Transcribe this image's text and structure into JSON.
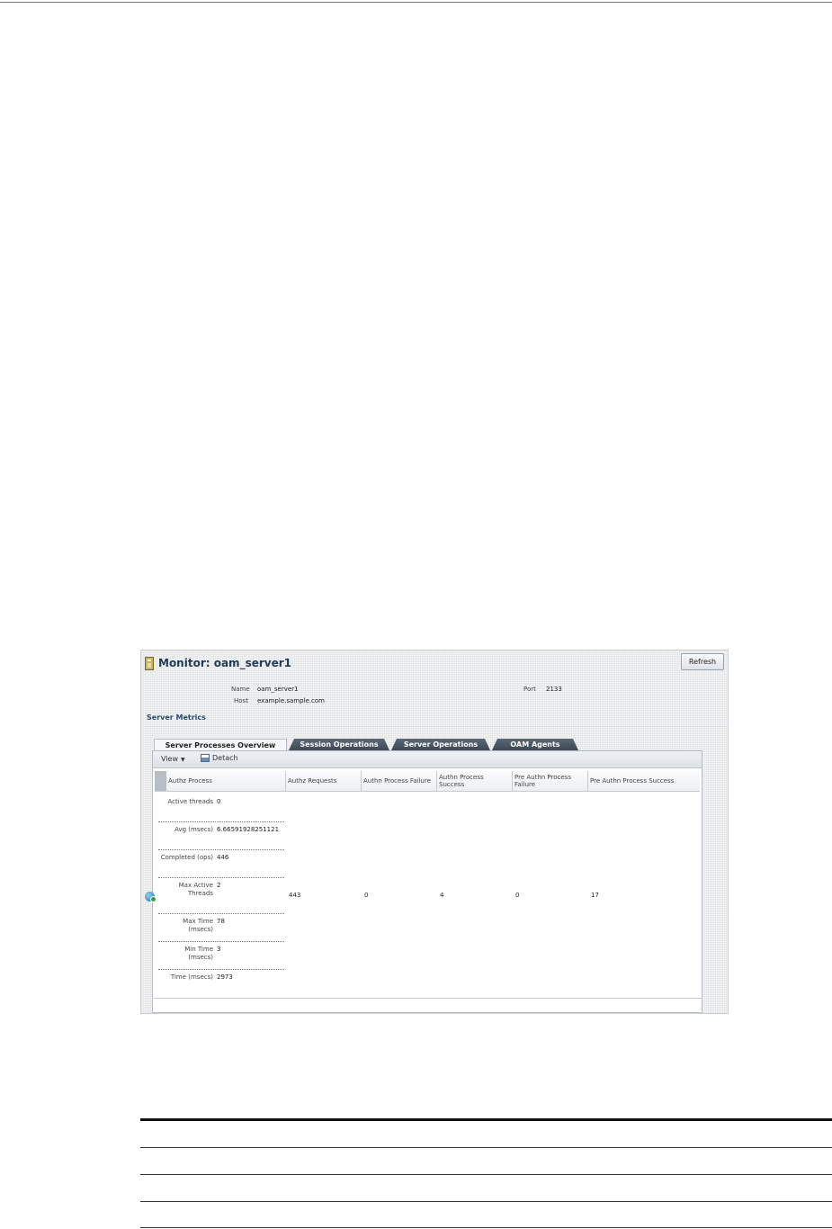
{
  "window": {
    "title": "Monitor: oam_server1",
    "refresh_label": "Refresh"
  },
  "server_info": {
    "name_label": "Name",
    "name_value": "oam_server1",
    "host_label": "Host",
    "host_value": "example.sample.com",
    "port_label": "Port",
    "port_value": "2133"
  },
  "section": {
    "title": "Server Metrics"
  },
  "tabs": [
    {
      "label": "Server Processes Overview",
      "active": true
    },
    {
      "label": "Session Operations",
      "active": false
    },
    {
      "label": "Server Operations",
      "active": false
    },
    {
      "label": "OAM Agents",
      "active": false
    }
  ],
  "toolbar": {
    "view_label": "View",
    "detach_label": "Detach"
  },
  "columns": [
    "Authz Process",
    "Authz Requests",
    "Authn Process Failure",
    "Authn Process Success",
    "Pre Authn Process Failure",
    "Pre Authn Process Success"
  ],
  "authz_process_metrics": [
    {
      "label": "Active threads",
      "value": "0"
    },
    {
      "label": "Avg (msecs)",
      "value": "6.66591928251121"
    },
    {
      "label": "Completed (ops)",
      "value": "446"
    },
    {
      "label": "Max Active Threads",
      "value": "2"
    },
    {
      "label": "Max Time (msecs)",
      "value": "78"
    },
    {
      "label": "Min Time (msecs)",
      "value": "3"
    },
    {
      "label": "Time (msecs)",
      "value": "2973"
    }
  ],
  "row_values": {
    "authz_requests": "443",
    "authn_process_failure": "0",
    "authn_process_success": "4",
    "pre_authn_process_failure": "0",
    "pre_authn_process_success": "17"
  }
}
